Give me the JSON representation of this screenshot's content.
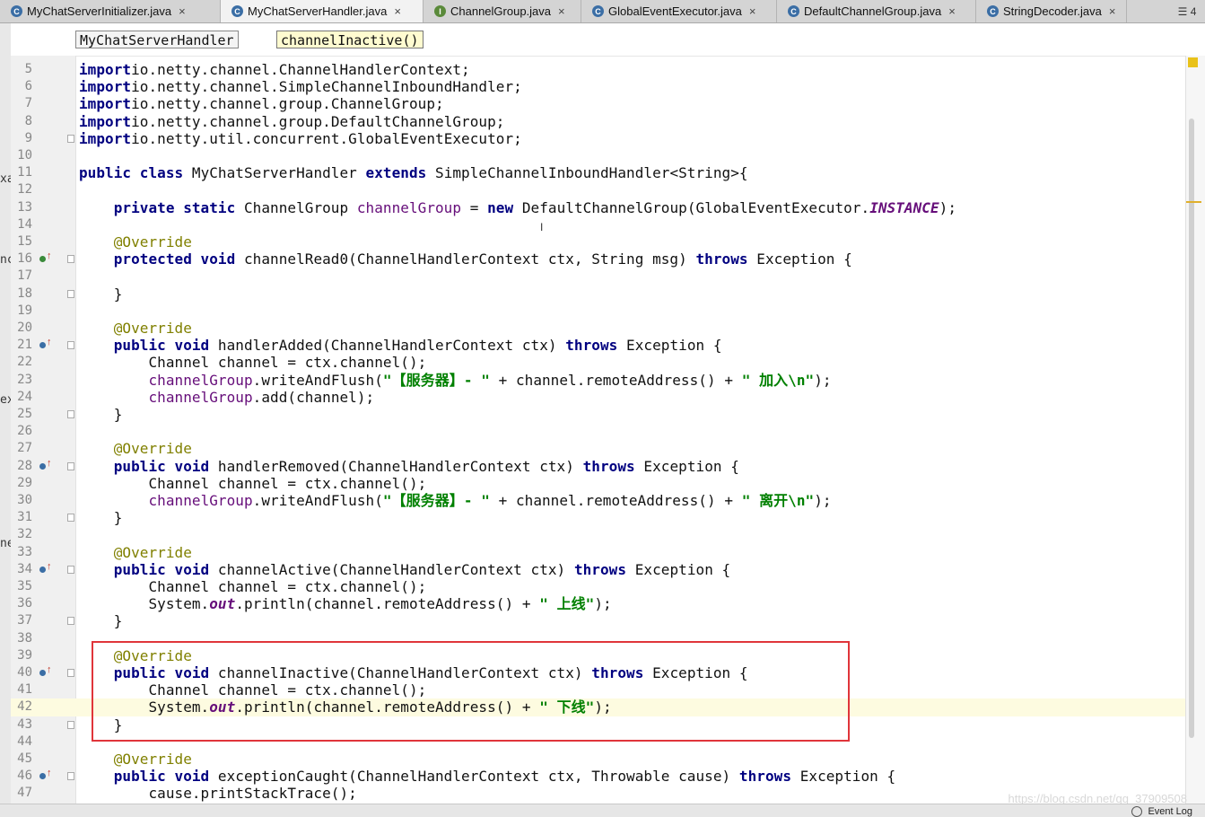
{
  "tabs": [
    {
      "label": "MyChatServerInitializer.java",
      "icon": "class-icon",
      "color": "#3b6ea5",
      "letter": "C",
      "active": false
    },
    {
      "label": "MyChatServerHandler.java",
      "icon": "class-icon",
      "color": "#3b6ea5",
      "letter": "C",
      "active": true
    },
    {
      "label": "ChannelGroup.java",
      "icon": "interface-icon",
      "color": "#5a8a3a",
      "letter": "I",
      "active": false
    },
    {
      "label": "GlobalEventExecutor.java",
      "icon": "class-icon",
      "color": "#3b6ea5",
      "letter": "C",
      "active": false
    },
    {
      "label": "DefaultChannelGroup.java",
      "icon": "class-icon",
      "color": "#3b6ea5",
      "letter": "C",
      "active": false
    },
    {
      "label": "StringDecoder.java",
      "icon": "class-icon",
      "color": "#3b6ea5",
      "letter": "C",
      "active": false
    }
  ],
  "tab_menu": "☰ 4",
  "breadcrumb": {
    "class_name": "MyChatServerHandler",
    "method_name": "channelInactive()"
  },
  "side_fragments": [
    "xa",
    "nc",
    "ex",
    "ne"
  ],
  "lines": [
    {
      "n": "5",
      "code": [
        [
          "kw",
          "import"
        ],
        [
          "",
          "io.netty.channel.ChannelHandlerContext;"
        ]
      ]
    },
    {
      "n": "6",
      "code": [
        [
          "kw",
          "import"
        ],
        [
          "",
          "io.netty.channel.SimpleChannelInboundHandler;"
        ]
      ]
    },
    {
      "n": "7",
      "code": [
        [
          "kw",
          "import"
        ],
        [
          "",
          "io.netty.channel.group.ChannelGroup;"
        ]
      ]
    },
    {
      "n": "8",
      "code": [
        [
          "kw",
          "import"
        ],
        [
          "",
          "io.netty.channel.group.DefaultChannelGroup;"
        ]
      ]
    },
    {
      "n": "9",
      "fold": true,
      "code": [
        [
          "kw",
          "import"
        ],
        [
          "",
          "io.netty.util.concurrent.GlobalEventExecutor;"
        ]
      ]
    },
    {
      "n": "10",
      "code": []
    },
    {
      "n": "11",
      "code": [
        [
          "kw",
          "public class"
        ],
        [
          "",
          " MyChatServerHandler "
        ],
        [
          "kw",
          "extends"
        ],
        [
          "",
          " SimpleChannelInboundHandler<String>{"
        ]
      ]
    },
    {
      "n": "12",
      "code": []
    },
    {
      "n": "13",
      "code": [
        [
          "",
          "    "
        ],
        [
          "kw",
          "private static"
        ],
        [
          "",
          " ChannelGroup "
        ],
        [
          "fl",
          "channelGroup"
        ],
        [
          "",
          " = "
        ],
        [
          "kw",
          "new"
        ],
        [
          "",
          " DefaultChannelGroup(GlobalEventExecutor."
        ],
        [
          "it",
          "INSTANCE"
        ],
        [
          "",
          ");"
        ]
      ]
    },
    {
      "n": "14",
      "code": []
    },
    {
      "n": "15",
      "code": [
        [
          "",
          "    "
        ],
        [
          "an",
          "@Override"
        ]
      ]
    },
    {
      "n": "16",
      "marker": "green",
      "fold": true,
      "code": [
        [
          "",
          "    "
        ],
        [
          "kw",
          "protected void"
        ],
        [
          "",
          " channelRead0(ChannelHandlerContext ctx, String msg) "
        ],
        [
          "kw",
          "throws"
        ],
        [
          "",
          " Exception {"
        ]
      ]
    },
    {
      "n": "17",
      "code": []
    },
    {
      "n": "18",
      "fold": true,
      "code": [
        [
          "",
          "    }"
        ]
      ]
    },
    {
      "n": "19",
      "code": []
    },
    {
      "n": "20",
      "code": [
        [
          "",
          "    "
        ],
        [
          "an",
          "@Override"
        ]
      ]
    },
    {
      "n": "21",
      "marker": "blue",
      "fold": true,
      "code": [
        [
          "",
          "    "
        ],
        [
          "kw",
          "public void"
        ],
        [
          "",
          " handlerAdded(ChannelHandlerContext ctx) "
        ],
        [
          "kw",
          "throws"
        ],
        [
          "",
          " Exception {"
        ]
      ]
    },
    {
      "n": "22",
      "code": [
        [
          "",
          "        Channel channel = ctx.channel();"
        ]
      ]
    },
    {
      "n": "23",
      "code": [
        [
          "",
          "        "
        ],
        [
          "fl",
          "channelGroup"
        ],
        [
          "",
          ".writeAndFlush("
        ],
        [
          "st",
          "\"【服务器】- \""
        ],
        [
          "",
          " + channel.remoteAddress() + "
        ],
        [
          "st",
          "\" 加入\\n\""
        ],
        [
          "",
          ");"
        ]
      ]
    },
    {
      "n": "24",
      "code": [
        [
          "",
          "        "
        ],
        [
          "fl",
          "channelGroup"
        ],
        [
          "",
          ".add(channel);"
        ]
      ]
    },
    {
      "n": "25",
      "fold": true,
      "code": [
        [
          "",
          "    }"
        ]
      ]
    },
    {
      "n": "26",
      "code": []
    },
    {
      "n": "27",
      "code": [
        [
          "",
          "    "
        ],
        [
          "an",
          "@Override"
        ]
      ]
    },
    {
      "n": "28",
      "marker": "blue",
      "fold": true,
      "code": [
        [
          "",
          "    "
        ],
        [
          "kw",
          "public void"
        ],
        [
          "",
          " handlerRemoved(ChannelHandlerContext ctx) "
        ],
        [
          "kw",
          "throws"
        ],
        [
          "",
          " Exception {"
        ]
      ]
    },
    {
      "n": "29",
      "code": [
        [
          "",
          "        Channel channel = ctx.channel();"
        ]
      ]
    },
    {
      "n": "30",
      "code": [
        [
          "",
          "        "
        ],
        [
          "fl",
          "channelGroup"
        ],
        [
          "",
          ".writeAndFlush("
        ],
        [
          "st",
          "\"【服务器】- \""
        ],
        [
          "",
          " + channel.remoteAddress() + "
        ],
        [
          "st",
          "\" 离开\\n\""
        ],
        [
          "",
          ");"
        ]
      ]
    },
    {
      "n": "31",
      "fold": true,
      "code": [
        [
          "",
          "    }"
        ]
      ]
    },
    {
      "n": "32",
      "code": []
    },
    {
      "n": "33",
      "code": [
        [
          "",
          "    "
        ],
        [
          "an",
          "@Override"
        ]
      ]
    },
    {
      "n": "34",
      "marker": "blue",
      "fold": true,
      "code": [
        [
          "",
          "    "
        ],
        [
          "kw",
          "public void"
        ],
        [
          "",
          " channelActive(ChannelHandlerContext ctx) "
        ],
        [
          "kw",
          "throws"
        ],
        [
          "",
          " Exception {"
        ]
      ]
    },
    {
      "n": "35",
      "code": [
        [
          "",
          "        Channel channel = ctx.channel();"
        ]
      ]
    },
    {
      "n": "36",
      "code": [
        [
          "",
          "        System."
        ],
        [
          "it",
          "out"
        ],
        [
          "",
          ".println(channel.remoteAddress() + "
        ],
        [
          "st",
          "\" 上线\""
        ],
        [
          "",
          ");"
        ]
      ]
    },
    {
      "n": "37",
      "fold": true,
      "code": [
        [
          "",
          "    }"
        ]
      ]
    },
    {
      "n": "38",
      "code": []
    },
    {
      "n": "39",
      "code": [
        [
          "",
          "    "
        ],
        [
          "an",
          "@Override"
        ]
      ]
    },
    {
      "n": "40",
      "marker": "blue",
      "fold": true,
      "code": [
        [
          "",
          "    "
        ],
        [
          "kw",
          "public void"
        ],
        [
          "",
          " channelInactive(ChannelHandlerContext ctx) "
        ],
        [
          "kw",
          "throws"
        ],
        [
          "",
          " Exception {"
        ]
      ]
    },
    {
      "n": "41",
      "code": [
        [
          "",
          "        Channel channel = ctx.channel();"
        ]
      ]
    },
    {
      "n": "42",
      "hl": true,
      "code": [
        [
          "",
          "        System."
        ],
        [
          "it",
          "out"
        ],
        [
          "",
          ".println(channel.remoteAddress() + "
        ],
        [
          "st",
          "\" 下线\""
        ],
        [
          "",
          ");"
        ]
      ]
    },
    {
      "n": "43",
      "fold": true,
      "code": [
        [
          "",
          "    }"
        ]
      ]
    },
    {
      "n": "44",
      "code": []
    },
    {
      "n": "45",
      "code": [
        [
          "",
          "    "
        ],
        [
          "an",
          "@Override"
        ]
      ]
    },
    {
      "n": "46",
      "marker": "blue",
      "fold": true,
      "code": [
        [
          "",
          "    "
        ],
        [
          "kw",
          "public void"
        ],
        [
          "",
          " exceptionCaught(ChannelHandlerContext ctx, Throwable cause) "
        ],
        [
          "kw",
          "throws"
        ],
        [
          "",
          " Exception {"
        ]
      ]
    },
    {
      "n": "47",
      "code": [
        [
          "",
          "        cause.printStackTrace();"
        ]
      ]
    }
  ],
  "status": {
    "event_log": "Event Log"
  },
  "watermark": "https://blog.csdn.net/qq_37909508"
}
